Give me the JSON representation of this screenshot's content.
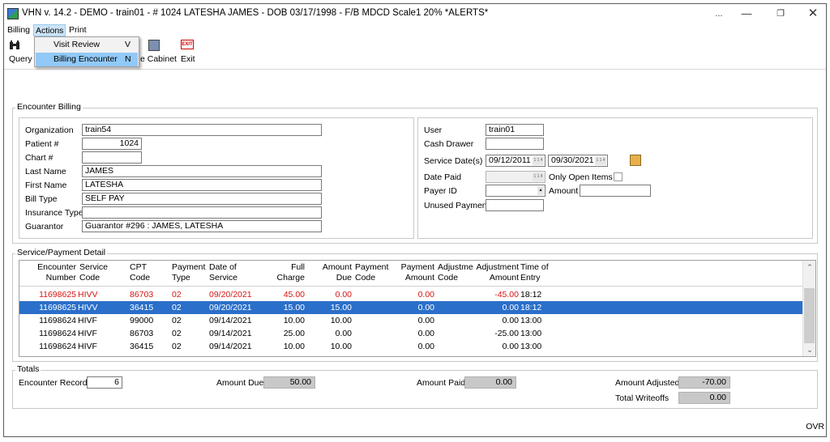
{
  "window": {
    "title": "VHN v. 14.2 - DEMO - train01 - # 1024  LATESHA JAMES - DOB 03/17/1998 - F/B MDCD  Scale1  20% *ALERTS*",
    "ellipsis": "...",
    "status_ovr": "OVR"
  },
  "menu": {
    "billing": "Billing",
    "actions": "Actions",
    "print": "Print"
  },
  "actions_menu": [
    {
      "label": "Visit Review",
      "key": "V"
    },
    {
      "label": "Billing Encounter",
      "key": "N"
    }
  ],
  "toolbar": {
    "query": "Query",
    "cabinet": "e Cabinet",
    "exit": "Exit",
    "exit_icon_text": "EXIT"
  },
  "encounter": {
    "group_title": "Encounter Billing",
    "labels": {
      "organization": "Organization",
      "patient": "Patient #",
      "chart": "Chart #",
      "last_name": "Last Name",
      "first_name": "First Name",
      "bill_type": "Bill Type",
      "insurance_type": "Insurance Type",
      "guarantor": "Guarantor",
      "user": "User",
      "cash_drawer": "Cash Drawer",
      "service_dates": "Service Date(s)",
      "date_paid": "Date Paid",
      "only_open": "Only Open Items",
      "payer_id": "Payer ID",
      "amount": "Amount",
      "unused_payment": "Unused Payment"
    },
    "values": {
      "organization": "train54",
      "patient": "1024",
      "chart": "",
      "last_name": "JAMES",
      "first_name": "LATESHA",
      "bill_type": "SELF PAY",
      "insurance_type": "",
      "guarantor": "Guarantor #296 : JAMES, LATESHA",
      "user": "train01",
      "cash_drawer": "",
      "service_from": "09/12/2011",
      "service_to": "09/30/2021",
      "date_paid": "",
      "payer_id": "",
      "amount": "",
      "unused_payment": ""
    },
    "date_btn": "1 1 4"
  },
  "detail": {
    "group_title": "Service/Payment Detail",
    "columns": [
      "Encounter\nNumber",
      "Service\nCode",
      "CPT\nCode",
      "Payment\nType",
      "Date of\nService",
      "Full\nCharge",
      "Amount\nDue",
      "Payment\nCode",
      "Payment\nAmount",
      "Adjustme\nCode",
      "Adjustment\nAmount",
      "Time of\nEntry"
    ],
    "rows": [
      {
        "enc": "11698625",
        "svc": "HIVV",
        "cpt": "86703",
        "ptype": "02",
        "date": "09/20/2021",
        "charge": "45.00",
        "due": "0.00",
        "pcode": "",
        "pamt": "0.00",
        "acode": "",
        "aamt": "-45.00",
        "time": "18:12"
      },
      {
        "enc": "11698625",
        "svc": "HIVV",
        "cpt": "36415",
        "ptype": "02",
        "date": "09/20/2021",
        "charge": "15.00",
        "due": "15.00",
        "pcode": "",
        "pamt": "0.00",
        "acode": "",
        "aamt": "0.00",
        "time": "18:12"
      },
      {
        "enc": "11698624",
        "svc": "HIVF",
        "cpt": "99000",
        "ptype": "02",
        "date": "09/14/2021",
        "charge": "10.00",
        "due": "10.00",
        "pcode": "",
        "pamt": "0.00",
        "acode": "",
        "aamt": "0.00",
        "time": "13:00"
      },
      {
        "enc": "11698624",
        "svc": "HIVF",
        "cpt": "86703",
        "ptype": "02",
        "date": "09/14/2021",
        "charge": "25.00",
        "due": "0.00",
        "pcode": "",
        "pamt": "0.00",
        "acode": "",
        "aamt": "-25.00",
        "time": "13:00"
      },
      {
        "enc": "11698624",
        "svc": "HIVF",
        "cpt": "36415",
        "ptype": "02",
        "date": "09/14/2021",
        "charge": "10.00",
        "due": "10.00",
        "pcode": "",
        "pamt": "0.00",
        "acode": "",
        "aamt": "0.00",
        "time": "13:00"
      }
    ],
    "row_colors": {
      "first_row_text": "#d41515",
      "selected_bg": "#2a6fc9"
    }
  },
  "totals": {
    "group_title": "Totals",
    "encounter_records_label": "Encounter Records",
    "encounter_records": "6",
    "amount_due_label": "Amount Due",
    "amount_due": "50.00",
    "amount_paid_label": "Amount Paid",
    "amount_paid": "0.00",
    "amount_adjusted_label": "Amount Adjusted",
    "amount_adjusted": "-70.00",
    "total_writeoffs_label": "Total Writeoffs",
    "total_writeoffs": "0.00"
  },
  "icons": {
    "app": "app-logo-icon",
    "query": "binoculars-icon",
    "cabinet": "file-cabinet-icon",
    "exit": "exit-icon",
    "calendar": "calendar-icon",
    "scroll_up": "chevron-up-icon",
    "scroll_down": "chevron-down-icon"
  }
}
